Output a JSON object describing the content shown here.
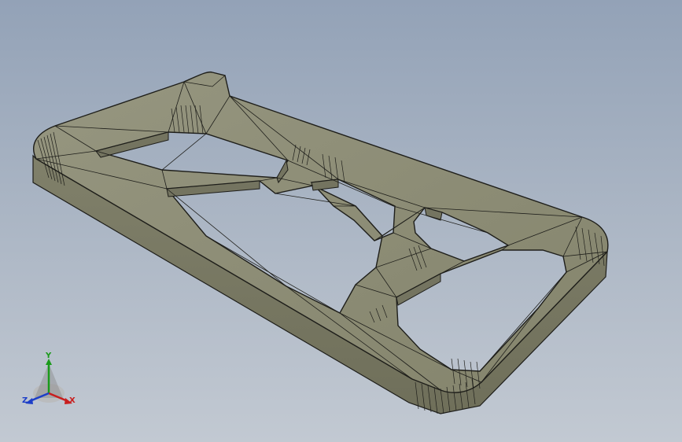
{
  "viewport": {
    "background_top": "#93a2b7",
    "background_bottom": "#c2c9d2"
  },
  "model": {
    "face_color": "#8a8a72",
    "side_color": "#7b7b64",
    "edge_color": "#1e1e1a"
  },
  "triad": {
    "x_label": "X",
    "y_label": "Y",
    "z_label": "Z",
    "x_color": "#c81e1e",
    "y_color": "#1a9a1a",
    "z_color": "#1c3ec8"
  }
}
